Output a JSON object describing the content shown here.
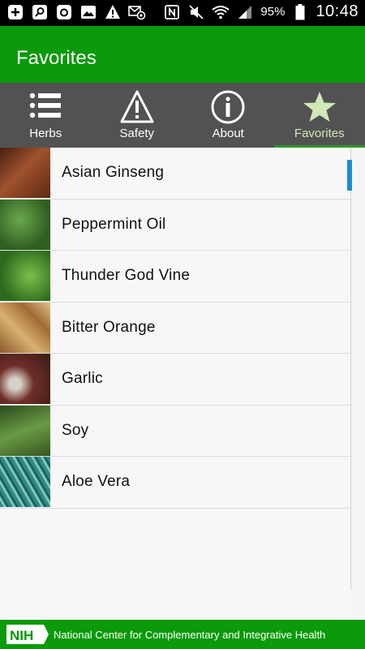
{
  "status_bar": {
    "icons_left": [
      "add-box-icon",
      "search-app-icon",
      "instagram-icon",
      "image-icon",
      "warning-icon",
      "mail-at-icon"
    ],
    "icons_right": [
      "nfc-icon",
      "mute-icon",
      "wifi-icon",
      "signal-icon"
    ],
    "battery_percent": "95%",
    "time": "10:48"
  },
  "app_bar": {
    "title": "Favorites"
  },
  "tabs": [
    {
      "label": "Herbs",
      "icon": "list-icon",
      "active": false
    },
    {
      "label": "Safety",
      "icon": "warning-icon",
      "active": false
    },
    {
      "label": "About",
      "icon": "info-icon",
      "active": false
    },
    {
      "label": "Favorites",
      "icon": "star-icon",
      "active": true
    }
  ],
  "favorites": [
    {
      "name": "Asian Ginseng",
      "thumb_color": "#7a3e22"
    },
    {
      "name": "Peppermint Oil",
      "thumb_color": "#3f7a2c"
    },
    {
      "name": "Thunder God Vine",
      "thumb_color": "#4d8a2f"
    },
    {
      "name": "Bitter Orange",
      "thumb_color": "#b88a4a"
    },
    {
      "name": "Garlic",
      "thumb_color": "#8a3e35"
    },
    {
      "name": "Soy",
      "thumb_color": "#4f7d3a"
    },
    {
      "name": "Aloe Vera",
      "thumb_color": "#3f8f8a"
    }
  ],
  "footer": {
    "logo_text": "NIH",
    "org_name": "National Center for Complementary and Integrative Health"
  },
  "colors": {
    "brand_green": "#0a9a0a",
    "tab_bar": "#525252",
    "active_tab_label": "#cfe8b8",
    "scroll_thumb": "#1a8fd1"
  }
}
